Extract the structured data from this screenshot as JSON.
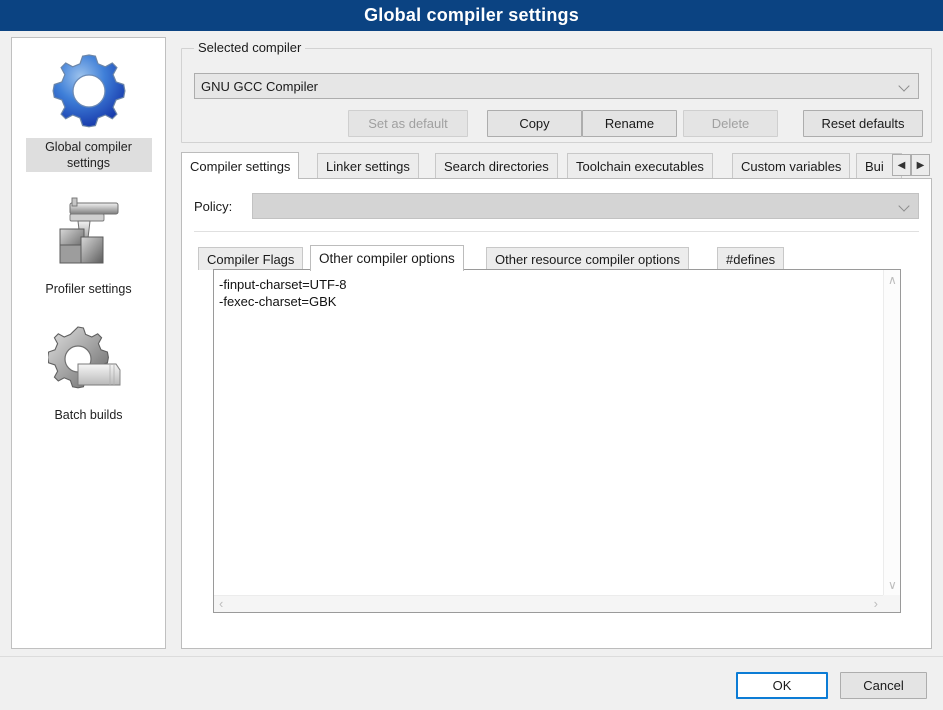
{
  "window": {
    "title": "Global compiler settings"
  },
  "sidebar": {
    "items": [
      {
        "label": "Global compiler settings",
        "icon": "blue-gear-icon",
        "selected": true
      },
      {
        "label": "Profiler settings",
        "icon": "caliper-blocks-icon",
        "selected": false
      },
      {
        "label": "Batch builds",
        "icon": "gear-papers-icon",
        "selected": false
      }
    ]
  },
  "selected_compiler": {
    "group_label": "Selected compiler",
    "combo_value": "GNU GCC Compiler",
    "buttons": [
      {
        "label": "Set as default",
        "disabled": true
      },
      {
        "label": "Copy",
        "disabled": false
      },
      {
        "label": "Rename",
        "disabled": false
      },
      {
        "label": "Delete",
        "disabled": true
      },
      {
        "label": "Reset defaults",
        "disabled": false
      }
    ]
  },
  "tabs": {
    "items": [
      {
        "label": "Compiler settings",
        "active": true
      },
      {
        "label": "Linker settings",
        "active": false
      },
      {
        "label": "Search directories",
        "active": false
      },
      {
        "label": "Toolchain executables",
        "active": false
      },
      {
        "label": "Custom variables",
        "active": false
      },
      {
        "label": "Bui",
        "active": false,
        "clipped": true
      }
    ],
    "scroll_left": "◀",
    "scroll_right": "▶"
  },
  "compiler_settings": {
    "policy_label": "Policy:",
    "policy_value": "",
    "inner_tabs": [
      {
        "label": "Compiler Flags",
        "active": false
      },
      {
        "label": "Other compiler options",
        "active": true
      },
      {
        "label": "Other resource compiler options",
        "active": false
      },
      {
        "label": "#defines",
        "active": false
      }
    ],
    "editor_value": "-finput-charset=UTF-8\n-fexec-charset=GBK",
    "scroll_up": "∧",
    "scroll_down": "∨",
    "scroll_left": "‹",
    "scroll_right": "›"
  },
  "footer": {
    "ok_label": "OK",
    "cancel_label": "Cancel"
  },
  "colors": {
    "titlebar": "#0b4382",
    "dialog_bg": "#f0f0f0",
    "focus_blue": "#0c7cd5",
    "gear_blue": "#2a5fd0"
  }
}
